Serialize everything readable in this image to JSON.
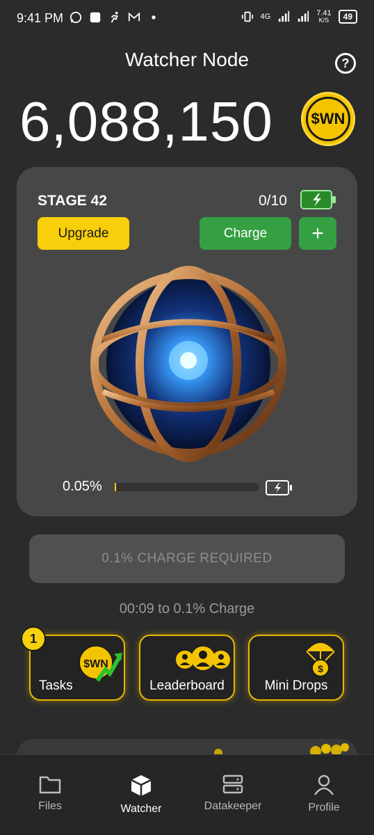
{
  "status_bar": {
    "time": "9:41 PM",
    "network": "4G",
    "speed": "7.41",
    "speed_unit": "K/S",
    "battery": "49"
  },
  "header": {
    "title": "Watcher Node",
    "help_glyph": "?"
  },
  "balance": {
    "amount": "6,088,150",
    "token": "$WN"
  },
  "stage": {
    "label": "STAGE 42",
    "charges": "0/10",
    "upgrade_label": "Upgrade",
    "charge_label": "Charge",
    "plus_label": "+",
    "progress_text": "0.05%",
    "progress_fraction": 0.005
  },
  "charge_required": {
    "label": "0.1% CHARGE REQUIRED",
    "timer_text": "00:09 to 0.1% Charge"
  },
  "tiles": {
    "tasks": {
      "label": "Tasks",
      "badge": "1",
      "coin_text": "$WN"
    },
    "leaderboard": {
      "label": "Leaderboard"
    },
    "mini_drops": {
      "label": "Mini Drops",
      "coin_text": "$"
    }
  },
  "nav": {
    "files": "Files",
    "watcher": "Watcher",
    "datakeeper": "Datakeeper",
    "profile": "Profile"
  },
  "colors": {
    "background": "#2b2b2b",
    "card": "#474747",
    "accent_yellow": "#f7cf0a",
    "accent_green": "#34a042"
  }
}
